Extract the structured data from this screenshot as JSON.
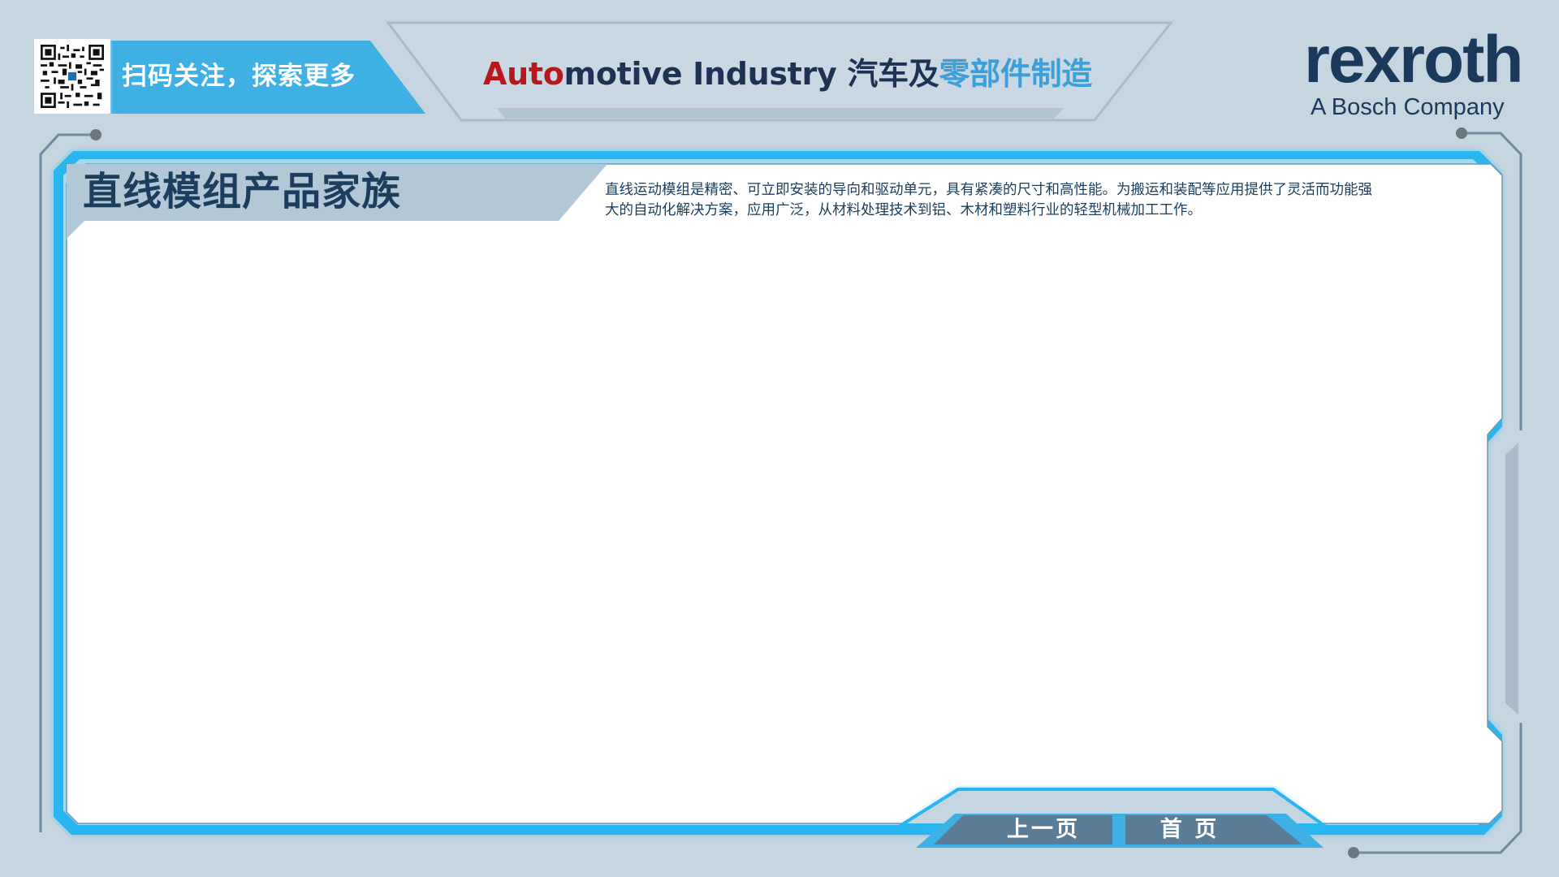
{
  "header": {
    "scan_label": "扫码关注，探索更多",
    "title_parts": [
      {
        "text": "Auto",
        "color": "#b8181d"
      },
      {
        "text": "motive Industry 汽车及",
        "color": "#1e3354"
      },
      {
        "text": "零部件制造",
        "color": "#3d9fd8"
      }
    ],
    "brand": {
      "name": "rexroth",
      "tagline": "A Bosch Company",
      "accent": "#e2001a"
    }
  },
  "main": {
    "title": "直线模组产品家族",
    "description": "直线运动模组是精密、可立即安装的导向和驱动单元，具有紧凑的尺寸和高性能。为搬运和装配等应用提供了灵活而功能强大的自动化解决方案，应用广泛，从材料处理技术到铝、木材和塑料行业的轻型机械加工工作。"
  },
  "footer": {
    "prev_label": "上一页",
    "home_label": "首 页"
  },
  "colors": {
    "background": "#c6d6e0",
    "accent_blue": "#29b6f0",
    "label_blue": "#3fb0e4",
    "navy": "#1b3d5e",
    "panel_bar": "#b3c8d6",
    "button_slate": "#5b7c96"
  },
  "icons": [
    "qr-code-icon",
    "connector-dot-icon"
  ]
}
